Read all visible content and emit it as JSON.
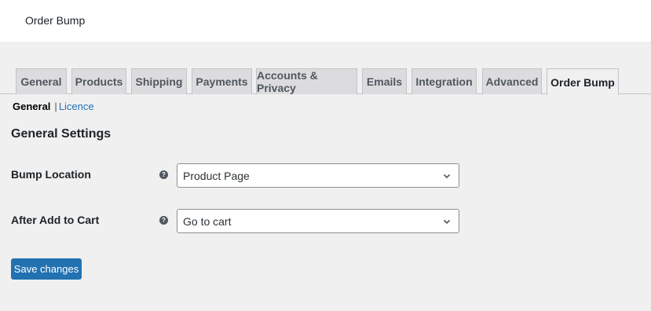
{
  "header": {
    "title": "Order Bump"
  },
  "tabs": [
    {
      "label": "General"
    },
    {
      "label": "Products"
    },
    {
      "label": "Shipping"
    },
    {
      "label": "Payments"
    },
    {
      "label": "Accounts & Privacy"
    },
    {
      "label": "Emails"
    },
    {
      "label": "Integration"
    },
    {
      "label": "Advanced"
    },
    {
      "label": "Order Bump",
      "active": true
    }
  ],
  "subnav": {
    "current": "General",
    "separator": "|",
    "link": "Licence"
  },
  "section": {
    "title": "General Settings"
  },
  "fields": {
    "bump_location": {
      "label": "Bump Location",
      "value": "Product Page"
    },
    "after_add_to_cart": {
      "label": "After Add to Cart",
      "value": "Go to cart"
    }
  },
  "actions": {
    "save_label": "Save changes"
  },
  "icons": {
    "help": "help-icon",
    "chevron": "chevron-down-icon"
  },
  "colors": {
    "accent": "#2271b1",
    "background": "#f0f0f1",
    "tab_inactive": "#dcdcde"
  }
}
